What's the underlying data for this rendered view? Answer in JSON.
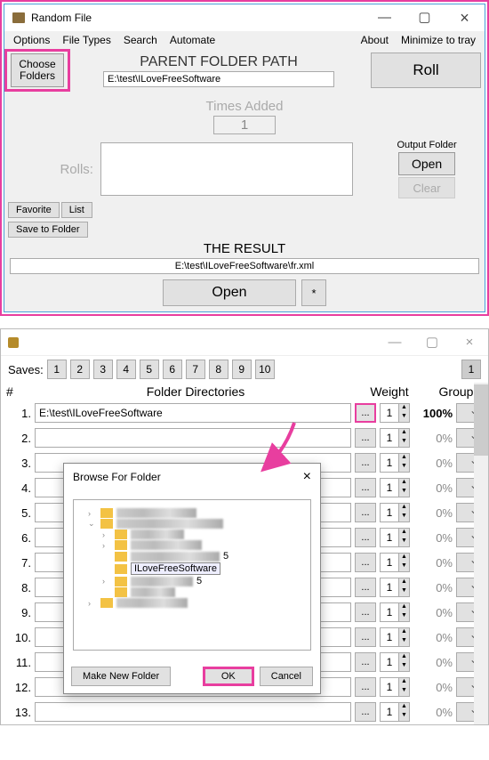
{
  "win1": {
    "title": "Random File",
    "menu": [
      "Options",
      "File Types",
      "Search",
      "Automate"
    ],
    "menu_right": [
      "About",
      "Minimize to tray"
    ],
    "choose": "Choose\nFolders",
    "parent_label": "PARENT FOLDER PATH",
    "parent_path": "E:\\test\\ILoveFreeSoftware",
    "roll": "Roll",
    "times_label": "Times Added",
    "times_value": "1",
    "rolls_label": "Rolls:",
    "output_label": "Output Folder",
    "open": "Open",
    "clear": "Clear",
    "favorite": "Favorite",
    "list": "List",
    "save_folder": "Save to Folder",
    "result_label": "THE RESULT",
    "result_value": "E:\\test\\ILoveFreeSoftware\\fr.xml",
    "open_big": "Open",
    "star": "*"
  },
  "win2": {
    "saves_label": "Saves:",
    "save_nums": [
      "1",
      "2",
      "3",
      "4",
      "5",
      "6",
      "7",
      "8",
      "9",
      "10"
    ],
    "save_extra": "1",
    "headers": {
      "h1": "#",
      "h2": "Folder Directories",
      "h3": "Weight",
      "h4": "Group"
    },
    "rows": [
      {
        "n": "1.",
        "path": "E:\\test\\ILoveFreeSoftware",
        "browse_hl": true,
        "spin": "1",
        "wt": "100%",
        "bold": true
      },
      {
        "n": "2.",
        "path": "",
        "spin": "1",
        "wt": "0%"
      },
      {
        "n": "3.",
        "path": "",
        "spin": "1",
        "wt": "0%"
      },
      {
        "n": "4.",
        "path": "",
        "spin": "1",
        "wt": "0%"
      },
      {
        "n": "5.",
        "path": "",
        "spin": "1",
        "wt": "0%"
      },
      {
        "n": "6.",
        "path": "",
        "spin": "1",
        "wt": "0%"
      },
      {
        "n": "7.",
        "path": "",
        "spin": "1",
        "wt": "0%"
      },
      {
        "n": "8.",
        "path": "",
        "spin": "1",
        "wt": "0%"
      },
      {
        "n": "9.",
        "path": "",
        "spin": "1",
        "wt": "0%"
      },
      {
        "n": "10.",
        "path": "",
        "spin": "1",
        "wt": "0%"
      },
      {
        "n": "11.",
        "path": "",
        "spin": "1",
        "wt": "0%"
      },
      {
        "n": "12.",
        "path": "",
        "spin": "1",
        "wt": "0%"
      },
      {
        "n": "13.",
        "path": "",
        "spin": "1",
        "wt": "0%"
      }
    ],
    "browse": "..."
  },
  "dialog": {
    "title": "Browse For Folder",
    "selected": "ILoveFreeSoftware",
    "tail5": "5",
    "make_new": "Make New Folder",
    "ok": "OK",
    "cancel": "Cancel"
  }
}
